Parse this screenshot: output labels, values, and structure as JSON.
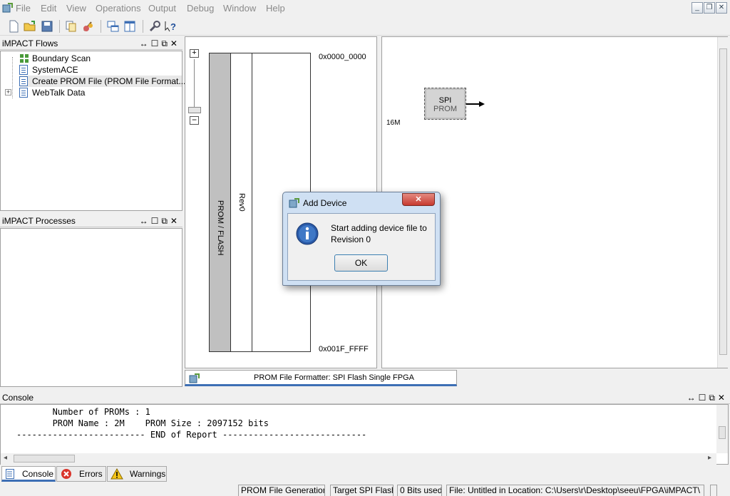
{
  "menubar": {
    "items": [
      "File",
      "Edit",
      "View",
      "Operations",
      "Output",
      "Debug",
      "Window",
      "Help"
    ]
  },
  "flows_panel": {
    "title": "iMPACT Flows",
    "items": [
      {
        "label": "Boundary Scan",
        "icon": "boundary-scan-icon"
      },
      {
        "label": "SystemACE",
        "icon": "document-icon"
      },
      {
        "label": "Create PROM File (PROM File Format...",
        "icon": "document-icon"
      },
      {
        "label": "WebTalk Data",
        "icon": "document-icon"
      }
    ]
  },
  "processes_panel": {
    "title": "iMPACT Processes"
  },
  "prom_view": {
    "address_start": "0x0000_0000",
    "address_end": "0x001F_FFFF",
    "column_label": "PROM / FLASH",
    "revision_label": "Rev0"
  },
  "device_view": {
    "size_label": "16M",
    "chip_title": "SPI",
    "chip_subtitle": "PROM"
  },
  "editor_tab": {
    "label": "PROM File Formatter: SPI Flash Single FPGA"
  },
  "console": {
    "title": "Console",
    "lines": [
      "       Number of PROMs : 1",
      "       PROM Name : 2M    PROM Size : 2097152 bits",
      "------------------------- END of Report ----------------------------"
    ]
  },
  "bottom_tabs": [
    {
      "label": "Console",
      "icon": "console-icon"
    },
    {
      "label": "Errors",
      "icon": "error-icon"
    },
    {
      "label": "Warnings",
      "icon": "warning-icon"
    }
  ],
  "statusbar": {
    "mode": "PROM File Generation",
    "target": "Target SPI Flash",
    "bits": "0 Bits used",
    "file": "File: Untitled in Location: C:\\Users\\r\\Desktop\\seeu\\FPGA\\iMPACT\\"
  },
  "dialog": {
    "title": "Add Device",
    "message_line1": "Start adding device file to",
    "message_line2": "Revision 0",
    "ok_label": "OK",
    "close_label": "✕"
  },
  "colors": {
    "accent_blue": "#3d6fb5",
    "dialog_frame": "#cfe0f3",
    "close_red": "#c9443a",
    "prom_column": "#c0c0c0"
  }
}
